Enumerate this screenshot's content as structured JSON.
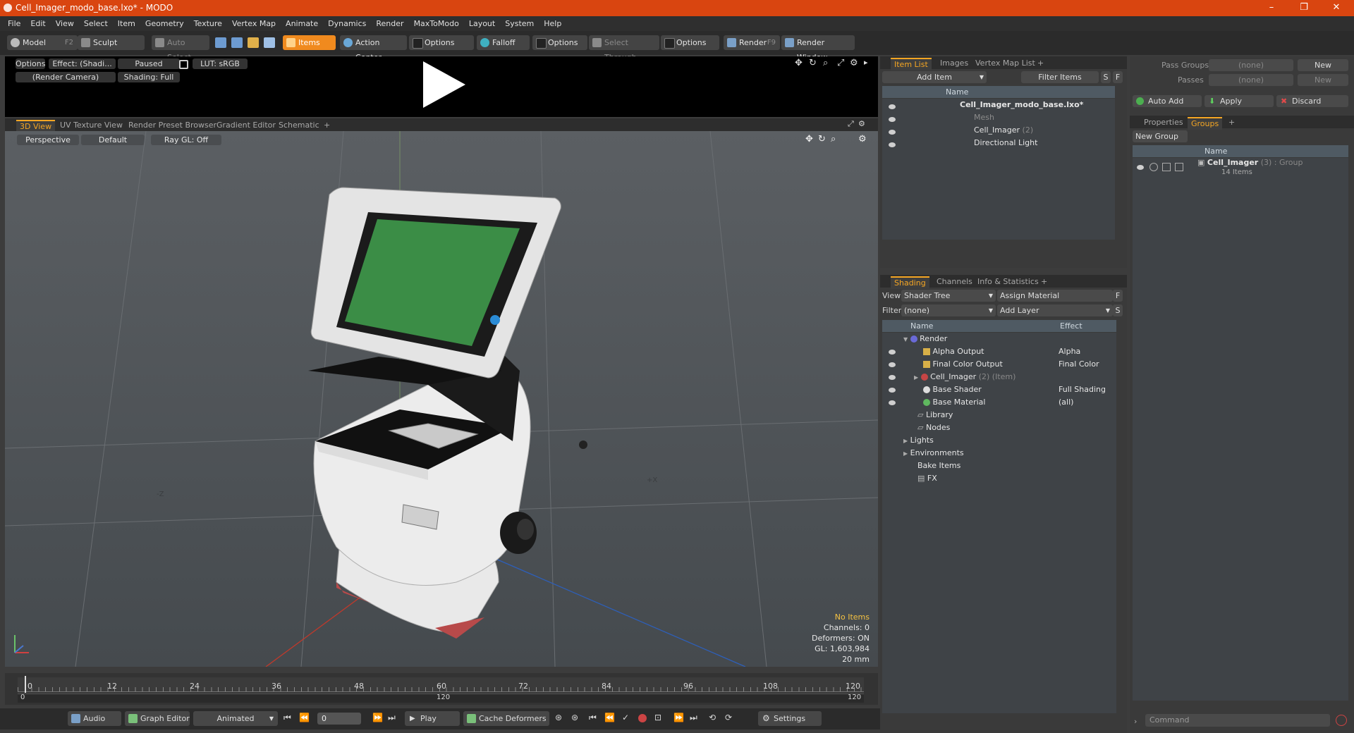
{
  "window": {
    "title": "Cell_Imager_modo_base.lxo* - MODO"
  },
  "menu": [
    "File",
    "Edit",
    "View",
    "Select",
    "Item",
    "Geometry",
    "Texture",
    "Vertex Map",
    "Animate",
    "Dynamics",
    "Render",
    "MaxToModo",
    "Layout",
    "System",
    "Help"
  ],
  "toolbar": {
    "model": "Model",
    "model_key": "F2",
    "sculpt": "Sculpt",
    "auto_select": "Auto Select",
    "items": "Items",
    "action_center": "Action Center",
    "options1": "Options",
    "falloff": "Falloff",
    "options2": "Options",
    "select_through": "Select Through",
    "options3": "Options",
    "render": "Render",
    "render_key": "F9",
    "render_window": "Render Window"
  },
  "preview": {
    "options": "Options",
    "effect": "Effect: (Shadi...",
    "paused": "Paused",
    "lut": "LUT: sRGB",
    "camera": "(Render Camera)",
    "shading": "Shading: Full"
  },
  "view_tabs": [
    "3D View",
    "UV Texture View",
    "Render Preset Browser",
    "Gradient Editor",
    "Schematic"
  ],
  "viewport": {
    "perspective": "Perspective",
    "default": "Default",
    "raygl": "Ray GL: Off",
    "axis_z": "-Z",
    "axis_x": "+X",
    "stats": {
      "no_items": "No Items",
      "channels": "Channels: 0",
      "deformers": "Deformers: ON",
      "gl": "GL: 1,603,984",
      "size": "20 mm"
    }
  },
  "timeline": {
    "ticks": [
      "0",
      "12",
      "24",
      "36",
      "48",
      "60",
      "72",
      "84",
      "96",
      "108",
      "120"
    ],
    "start": "0",
    "mid": "120",
    "end": "120"
  },
  "bottombar": {
    "audio": "Audio",
    "graph_editor": "Graph Editor",
    "animated": "Animated",
    "frame": "0",
    "play": "Play",
    "cache": "Cache Deformers",
    "settings": "Settings"
  },
  "item_list": {
    "tabs": [
      "Item List",
      "Images",
      "Vertex Map List"
    ],
    "add_item": "Add Item",
    "filter": "Filter Items",
    "s": "S",
    "f": "F",
    "name_col": "Name",
    "rows": [
      {
        "label": "Cell_Imager_modo_base.lxo*",
        "extra": ""
      },
      {
        "label": "Mesh",
        "extra": ""
      },
      {
        "label": "Cell_Imager",
        "extra": "(2)"
      },
      {
        "label": "Directional Light",
        "extra": ""
      }
    ]
  },
  "shading": {
    "tabs": [
      "Shading",
      "Channels",
      "Info & Statistics"
    ],
    "view_label": "View",
    "view_value": "Shader Tree",
    "assign": "Assign Material",
    "f": "F",
    "filter_label": "Filter",
    "filter_value": "(none)",
    "add_layer": "Add Layer",
    "s": "S",
    "name_col": "Name",
    "effect_col": "Effect",
    "rows": [
      {
        "label": "Render",
        "extra": "",
        "effect": ""
      },
      {
        "label": "Alpha Output",
        "extra": "",
        "effect": "Alpha"
      },
      {
        "label": "Final Color Output",
        "extra": "",
        "effect": "Final Color"
      },
      {
        "label": "Cell_Imager",
        "extra": "(2) (Item)",
        "effect": ""
      },
      {
        "label": "Base Shader",
        "extra": "",
        "effect": "Full Shading"
      },
      {
        "label": "Base Material",
        "extra": "",
        "effect": "(all)"
      },
      {
        "label": "Library",
        "extra": "",
        "effect": ""
      },
      {
        "label": "Nodes",
        "extra": "",
        "effect": ""
      },
      {
        "label": "Lights",
        "extra": "",
        "effect": ""
      },
      {
        "label": "Environments",
        "extra": "",
        "effect": ""
      },
      {
        "label": "Bake Items",
        "extra": "",
        "effect": ""
      },
      {
        "label": "FX",
        "extra": "",
        "effect": ""
      }
    ]
  },
  "groups": {
    "pass_groups_label": "Pass Groups",
    "pass_groups_value": "(none)",
    "new1": "New",
    "passes_label": "Passes",
    "passes_value": "(none)",
    "new2": "New",
    "auto_add": "Auto Add",
    "apply": "Apply",
    "discard": "Discard",
    "tabs": [
      "Properties",
      "Groups"
    ],
    "new_group": "New Group",
    "name_col": "Name",
    "group_name": "Cell_Imager",
    "group_extra": "(3) : Group",
    "group_items": "14 Items",
    "command": "Command"
  },
  "colors": {
    "accent": "#f5a623",
    "titlebar": "#d94510"
  }
}
